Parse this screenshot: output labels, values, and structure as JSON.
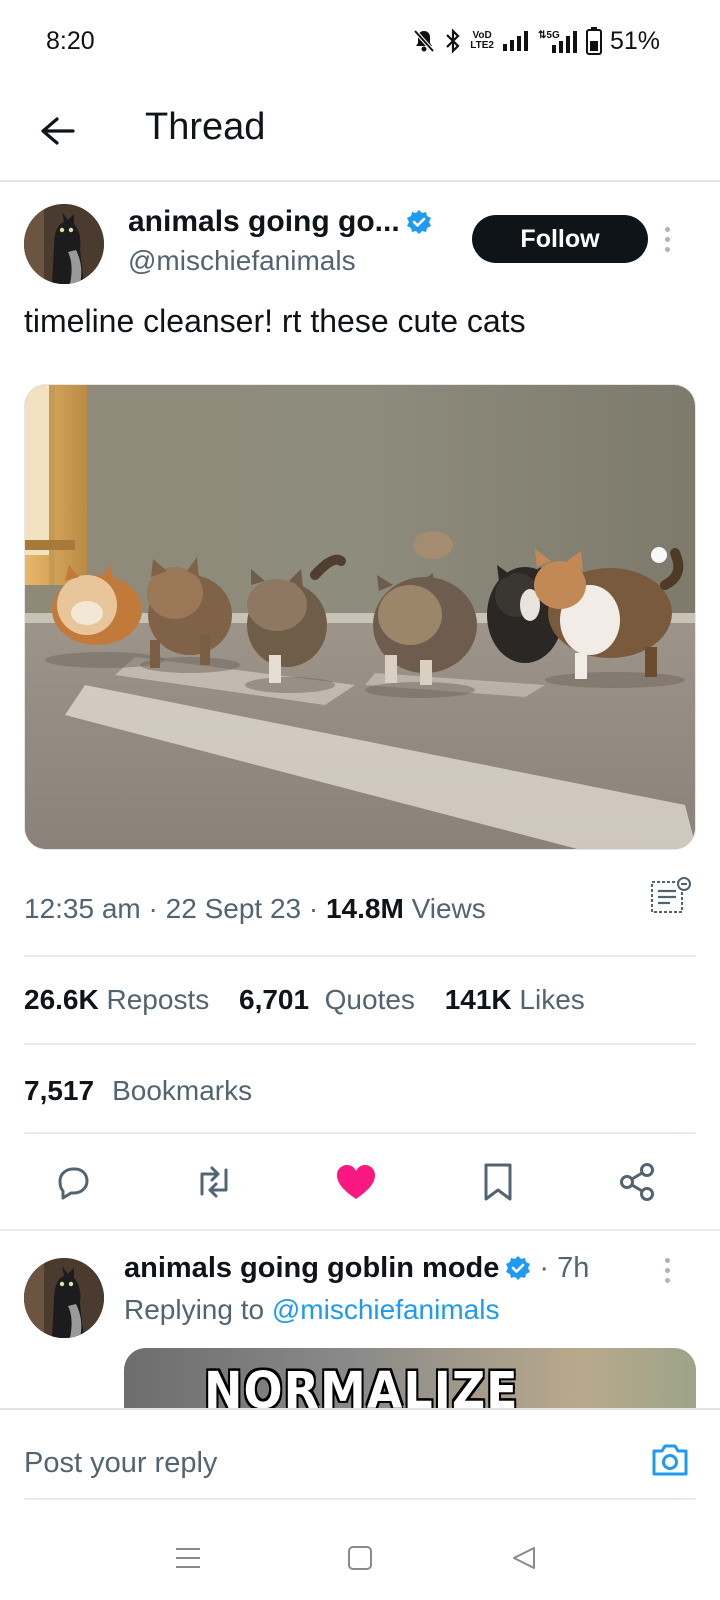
{
  "status_bar": {
    "time": "8:20",
    "battery": "51%",
    "icons": [
      "mute-bell-icon",
      "bluetooth-icon",
      "volte-icon",
      "signal-icon",
      "5g-signal-icon",
      "battery-icon"
    ],
    "volte_top": "VoD",
    "volte_bottom": "LTE2",
    "network": "5G"
  },
  "header": {
    "title": "Thread",
    "back_icon": "arrow-left-icon"
  },
  "post": {
    "author_name": "animals going go...",
    "handle": "@mischiefanimals",
    "follow_label": "Follow",
    "text": "timeline cleanser! rt these cute cats",
    "time": "12:35 am",
    "date": "22 Sept 23",
    "views_count": "14.8M",
    "views_label": "Views",
    "stats": {
      "reposts_count": "26.6K",
      "reposts_label": "Reposts",
      "quotes_count": "6,701",
      "quotes_label": "Quotes",
      "likes_count": "141K",
      "likes_label": "Likes",
      "bookmarks_count": "7,517",
      "bookmarks_label": "Bookmarks"
    },
    "actions": [
      "reply-icon",
      "repost-icon",
      "like-icon",
      "bookmark-icon",
      "share-icon"
    ]
  },
  "reply": {
    "author_name": "animals going goblin mode",
    "time": "7h",
    "replying_prefix": "Replying to",
    "replying_handle": "@mischiefanimals",
    "media_text": "NORMALIZE BEING A"
  },
  "reply_bar": {
    "placeholder": "Post your reply"
  },
  "colors": {
    "accent": "#1d9bf0",
    "like": "#f91880",
    "text_primary": "#0f1419",
    "text_secondary": "#536471"
  }
}
